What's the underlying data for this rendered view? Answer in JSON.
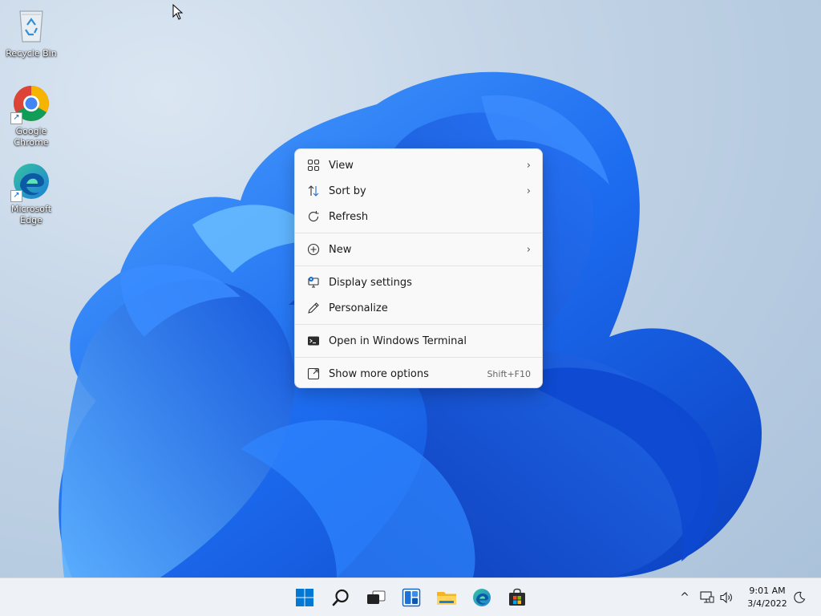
{
  "desktop": {
    "icons": [
      {
        "label": "Recycle Bin",
        "icon": "recycle-bin-icon"
      },
      {
        "label": "Google Chrome",
        "icon": "chrome-icon"
      },
      {
        "label": "Microsoft Edge",
        "icon": "edge-icon"
      }
    ]
  },
  "context_menu": {
    "items": [
      {
        "label": "View",
        "icon": "view-grid-icon",
        "submenu": true
      },
      {
        "label": "Sort by",
        "icon": "sort-icon",
        "submenu": true
      },
      {
        "label": "Refresh",
        "icon": "refresh-icon"
      },
      {
        "label": "New",
        "icon": "plus-circle-icon",
        "submenu": true
      },
      {
        "label": "Display settings",
        "icon": "display-settings-icon"
      },
      {
        "label": "Personalize",
        "icon": "pen-icon"
      },
      {
        "label": "Open in Windows Terminal",
        "icon": "terminal-icon"
      },
      {
        "label": "Show more options",
        "icon": "expand-icon",
        "shortcut": "Shift+F10"
      }
    ],
    "chevron": "›"
  },
  "taskbar": {
    "apps": [
      {
        "name": "Start",
        "icon": "windows-start-icon"
      },
      {
        "name": "Search",
        "icon": "search-icon"
      },
      {
        "name": "Task View",
        "icon": "task-view-icon"
      },
      {
        "name": "Widgets",
        "icon": "widgets-icon"
      },
      {
        "name": "File Explorer",
        "icon": "file-explorer-icon"
      },
      {
        "name": "Microsoft Edge",
        "icon": "edge-icon"
      },
      {
        "name": "Microsoft Store",
        "icon": "store-icon"
      }
    ],
    "tray": {
      "chevron": "^",
      "network_icon": "network-icon",
      "volume_icon": "volume-icon",
      "time": "9:01 AM",
      "date": "3/4/2022",
      "focus_icon": "moon-icon"
    }
  },
  "colors": {
    "accent": "#0067c0",
    "wallpaper_bloom": "#1f6fe8",
    "menu_bg": "#f9f9f9",
    "taskbar_bg": "#eef1f5"
  }
}
